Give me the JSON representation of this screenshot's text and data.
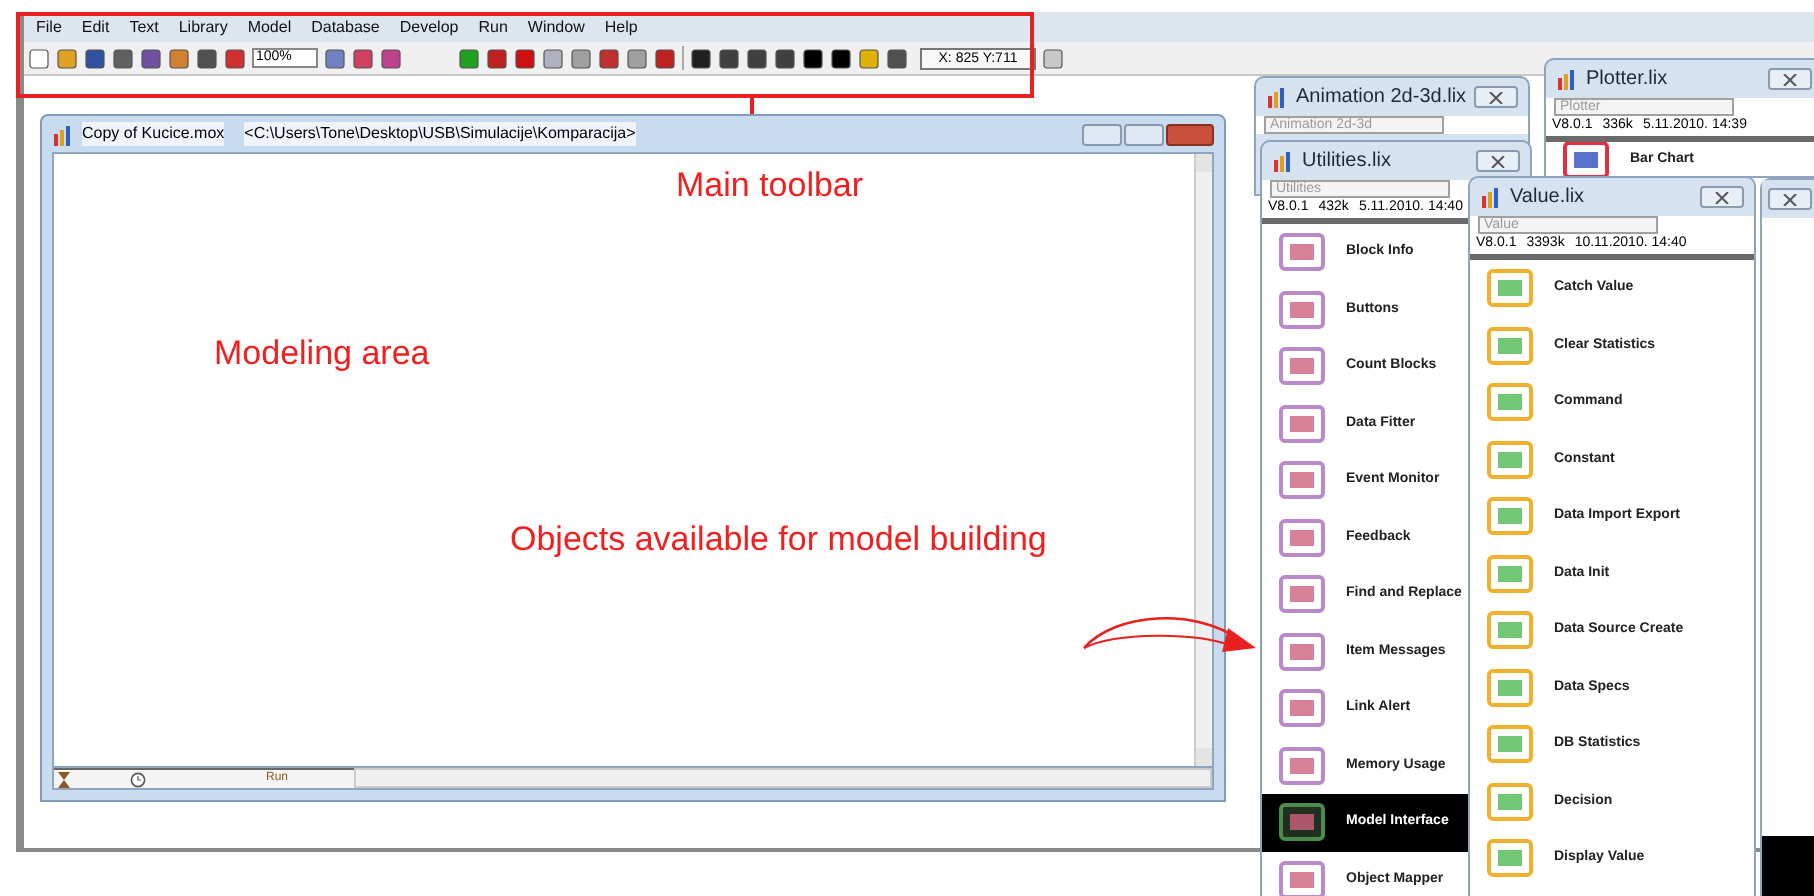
{
  "menu": [
    "File",
    "Edit",
    "Text",
    "Library",
    "Model",
    "Database",
    "Develop",
    "Run",
    "Window",
    "Help"
  ],
  "toolbar": {
    "zoom": "100%",
    "coordinates": "X: 825 Y:711"
  },
  "document_window": {
    "title": "Copy of Kucice.mox",
    "path": "<C:\\Users\\Tone\\Desktop\\USB\\Simulacije\\Komparacija>",
    "status": "Run"
  },
  "annotations": [
    {
      "text": "Main toolbar",
      "kind": "label"
    },
    {
      "text": "Modeling area",
      "kind": "label"
    },
    {
      "text": "Objects available for model building",
      "kind": "label"
    }
  ],
  "libraries": [
    {
      "title": "Animation 2d-3d.lix",
      "dropdown": "Animation 2d-3d"
    },
    {
      "title": "Plotter.lix",
      "dropdown": "Plotter",
      "version": "V8.0.1",
      "size": "336k",
      "date": "5.11.2010. 14:39",
      "items": [
        {
          "label": "Bar Chart",
          "selected": false
        }
      ]
    },
    {
      "title": "Utilities.lix",
      "dropdown": "Utilities",
      "version": "V8.0.1",
      "size": "432k",
      "date": "5.11.2010. 14:40",
      "items": [
        {
          "label": "Block Info",
          "selected": false
        },
        {
          "label": "Buttons",
          "selected": false
        },
        {
          "label": "Count Blocks",
          "selected": false
        },
        {
          "label": "Data Fitter",
          "selected": false
        },
        {
          "label": "Event Monitor",
          "selected": false
        },
        {
          "label": "Feedback",
          "selected": false
        },
        {
          "label": "Find and Replace",
          "selected": false
        },
        {
          "label": "Item Messages",
          "selected": false
        },
        {
          "label": "Link Alert",
          "selected": false
        },
        {
          "label": "Memory Usage",
          "selected": false
        },
        {
          "label": "Model Interface",
          "selected": true
        },
        {
          "label": "Object Mapper",
          "selected": false
        }
      ]
    },
    {
      "title": "Value.lix",
      "dropdown": "Value",
      "version": "V8.0.1",
      "size": "3393k",
      "date": "10.11.2010. 14:40",
      "items": [
        {
          "label": "Catch Value",
          "selected": false
        },
        {
          "label": "Clear Statistics",
          "selected": false
        },
        {
          "label": "Command",
          "selected": false
        },
        {
          "label": "Constant",
          "selected": false
        },
        {
          "label": "Data Import Export",
          "selected": false
        },
        {
          "label": "Data Init",
          "selected": false
        },
        {
          "label": "Data Source Create",
          "selected": false
        },
        {
          "label": "Data Specs",
          "selected": false
        },
        {
          "label": "DB Statistics",
          "selected": false
        },
        {
          "label": "Decision",
          "selected": false
        },
        {
          "label": "Display Value",
          "selected": false
        }
      ]
    }
  ]
}
